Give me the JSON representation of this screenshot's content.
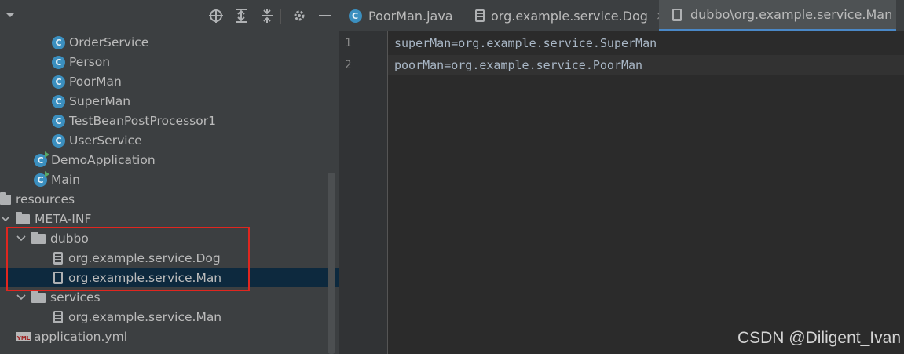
{
  "project_tree": {
    "items": [
      {
        "label": "OrderService",
        "icon": "class-icon"
      },
      {
        "label": "Person",
        "icon": "class-icon"
      },
      {
        "label": "PoorMan",
        "icon": "class-icon"
      },
      {
        "label": "SuperMan",
        "icon": "class-icon"
      },
      {
        "label": "TestBeanPostProcessor1",
        "icon": "class-icon"
      },
      {
        "label": "UserService",
        "icon": "class-icon"
      },
      {
        "label": "DemoApplication",
        "icon": "runnable-class-icon"
      },
      {
        "label": "Main",
        "icon": "runnable-class-icon"
      },
      {
        "label": "resources",
        "icon": "resources-folder-icon"
      },
      {
        "label": "META-INF",
        "icon": "folder-icon"
      },
      {
        "label": "dubbo",
        "icon": "folder-icon"
      },
      {
        "label": "org.example.service.Dog",
        "icon": "file-icon"
      },
      {
        "label": "org.example.service.Man",
        "icon": "file-icon"
      },
      {
        "label": "services",
        "icon": "folder-icon"
      },
      {
        "label": "org.example.service.Man",
        "icon": "file-icon"
      },
      {
        "label": "application.yml",
        "icon": "yml-icon"
      }
    ]
  },
  "tabs": [
    {
      "label": "PoorMan.java",
      "icon": "class-icon"
    },
    {
      "label": "org.example.service.Dog",
      "icon": "file-icon",
      "close": "×"
    },
    {
      "label": "dubbo\\org.example.service.Man",
      "icon": "file-icon",
      "active": true
    }
  ],
  "editor": {
    "lines": [
      {
        "number": "1",
        "text": "superMan=org.example.service.SuperMan"
      },
      {
        "number": "2",
        "text": "poorMan=org.example.service.PoorMan"
      }
    ]
  },
  "yml_badge": "YML",
  "class_glyph": "C",
  "watermark": "CSDN @Diligent_Ivan",
  "colors": {
    "accent": "#4a88c7",
    "highlight_box": "#e0261f",
    "selection": "#0d293e",
    "class_icon": "#3b8fbf"
  }
}
